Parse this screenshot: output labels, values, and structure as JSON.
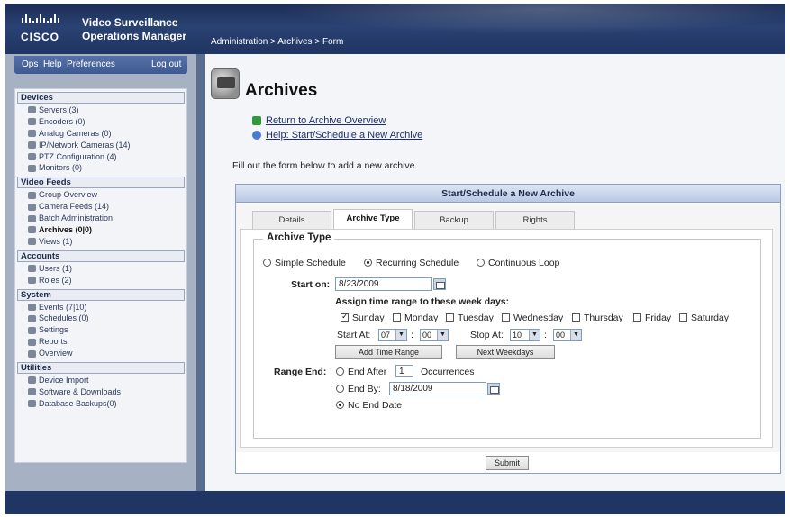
{
  "app": {
    "brand": "CISCO",
    "title_line1": "Video Surveillance",
    "title_line2": "Operations Manager",
    "breadcrumb": "Administration > Archives > Form"
  },
  "topnav": {
    "ops": "Ops",
    "help": "Help",
    "preferences": "Preferences",
    "logout": "Log out"
  },
  "sidebar": {
    "sections": [
      {
        "title": "Devices",
        "items": [
          "Servers (3)",
          "Encoders (0)",
          "Analog Cameras (0)",
          "IP/Network Cameras (14)",
          "PTZ Configuration (4)",
          "Monitors (0)"
        ]
      },
      {
        "title": "Video Feeds",
        "items": [
          "Group Overview",
          "Camera Feeds (14)",
          "Batch Administration",
          "Archives (0|0)",
          "Views (1)"
        ]
      },
      {
        "title": "Accounts",
        "items": [
          "Users (1)",
          "Roles (2)"
        ]
      },
      {
        "title": "System",
        "items": [
          "Events (7|10)",
          "Schedules (0)",
          "Settings",
          "Reports",
          "Overview"
        ]
      },
      {
        "title": "Utilities",
        "items": [
          "Device Import",
          "Software & Downloads",
          "Database Backups(0)"
        ]
      }
    ]
  },
  "page": {
    "title": "Archives",
    "link_return": "Return to Archive Overview",
    "link_help": "Help: Start/Schedule a New Archive",
    "intro": "Fill out the form below to add a new archive."
  },
  "panel": {
    "title": "Start/Schedule a New Archive",
    "tabs": [
      "Details",
      "Archive Type",
      "Backup",
      "Rights"
    ],
    "active_tab": "Archive Type"
  },
  "form": {
    "legend": "Archive Type",
    "type_options": [
      "Simple Schedule",
      "Recurring Schedule",
      "Continuous Loop"
    ],
    "type_selected": "Recurring Schedule",
    "start_on_label": "Start on:",
    "start_on_value": "8/23/2009",
    "assign_label": "Assign time range to these week days:",
    "weekdays": [
      "Sunday",
      "Monday",
      "Tuesday",
      "Wednesday",
      "Thursday",
      "Friday",
      "Saturday"
    ],
    "weekdays_checked": [
      "Sunday"
    ],
    "start_at_label": "Start At:",
    "start_hour": "07",
    "start_min": "00",
    "stop_at_label": "Stop At:",
    "stop_hour": "10",
    "stop_min": "00",
    "time_sep": ":",
    "add_time_range": "Add Time Range",
    "next_weekdays": "Next Weekdays",
    "range_end_label": "Range End:",
    "end_after_label": "End After",
    "end_after_value": "1",
    "occurrences_label": "Occurrences",
    "end_by_label": "End By:",
    "end_by_value": "8/18/2009",
    "no_end_label": "No End Date",
    "range_end_selected": "No End Date",
    "submit": "Submit"
  },
  "colors": {
    "header": "#1f3563",
    "accent_link": "#1c2f6b",
    "panel_border": "#8aa0c3"
  }
}
